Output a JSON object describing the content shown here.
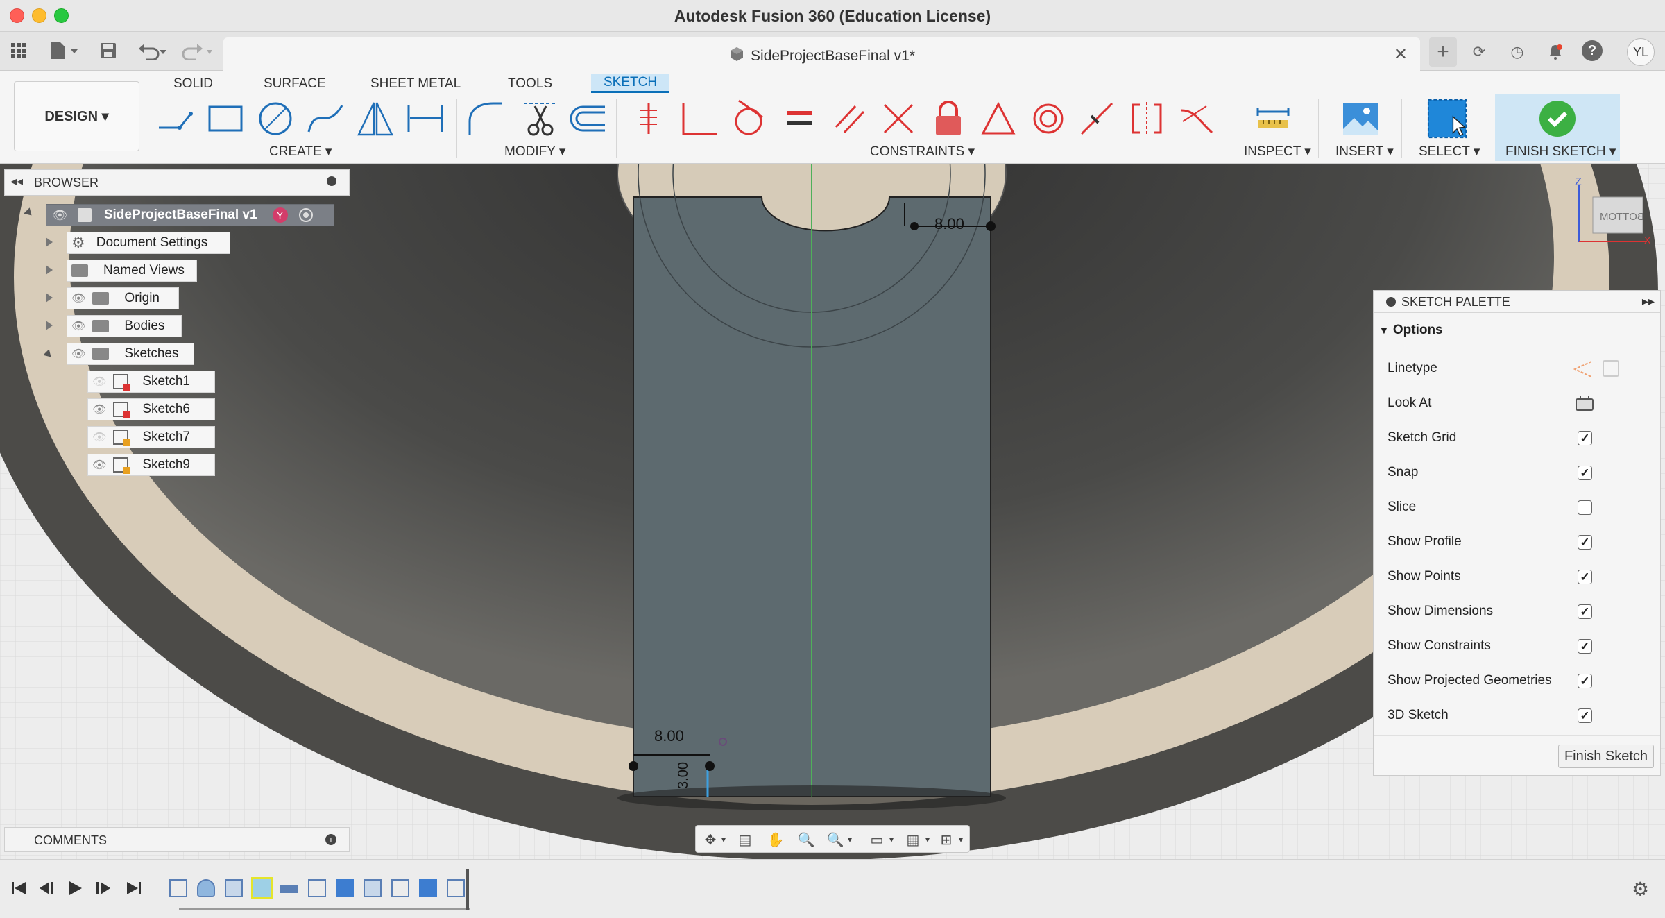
{
  "window": {
    "title": "Autodesk Fusion 360 (Education License)"
  },
  "document_tab": {
    "title": "SideProjectBaseFinal v1*",
    "close": "✕"
  },
  "user": {
    "initials": "YL"
  },
  "ribbon": {
    "workspace": "DESIGN ▾",
    "tabs": [
      "SOLID",
      "SURFACE",
      "SHEET METAL",
      "TOOLS",
      "SKETCH"
    ],
    "active_tab": "SKETCH",
    "groups": {
      "create": "CREATE ▾",
      "modify": "MODIFY ▾",
      "constraints": "CONSTRAINTS ▾",
      "inspect": "INSPECT ▾",
      "insert": "INSERT ▾",
      "select": "SELECT ▾",
      "finish": "FINISH SKETCH ▾"
    }
  },
  "browser": {
    "title": "BROWSER",
    "root": "SideProjectBaseFinal v1",
    "items": [
      {
        "label": "Document Settings"
      },
      {
        "label": "Named Views"
      },
      {
        "label": "Origin"
      },
      {
        "label": "Bodies"
      },
      {
        "label": "Sketches"
      }
    ],
    "sketches": [
      {
        "label": "Sketch1"
      },
      {
        "label": "Sketch6"
      },
      {
        "label": "Sketch7"
      },
      {
        "label": "Sketch9"
      }
    ]
  },
  "comments": {
    "title": "COMMENTS"
  },
  "viewcube": {
    "face": "BOTTOM",
    "axis_z": "Z",
    "axis_x": "X"
  },
  "dimensions": {
    "top": "8.00",
    "bottom": "8.00",
    "bottom_vertical": "3.00"
  },
  "palette": {
    "title": "SKETCH PALETTE",
    "section": "Options",
    "rows": [
      {
        "label": "Linetype"
      },
      {
        "label": "Look At"
      },
      {
        "label": "Sketch Grid",
        "checked": true
      },
      {
        "label": "Snap",
        "checked": true
      },
      {
        "label": "Slice",
        "checked": false
      },
      {
        "label": "Show Profile",
        "checked": true
      },
      {
        "label": "Show Points",
        "checked": true
      },
      {
        "label": "Show Dimensions",
        "checked": true
      },
      {
        "label": "Show Constraints",
        "checked": true
      },
      {
        "label": "Show Projected Geometries",
        "checked": true
      },
      {
        "label": "3D Sketch",
        "checked": true
      }
    ],
    "finish_button": "Finish Sketch"
  },
  "colors": {
    "accent": "#0a6fb8",
    "finish_green": "#3cb043",
    "sketch_fill": "#5e6b70",
    "ring_tan": "#d8ccb9"
  }
}
